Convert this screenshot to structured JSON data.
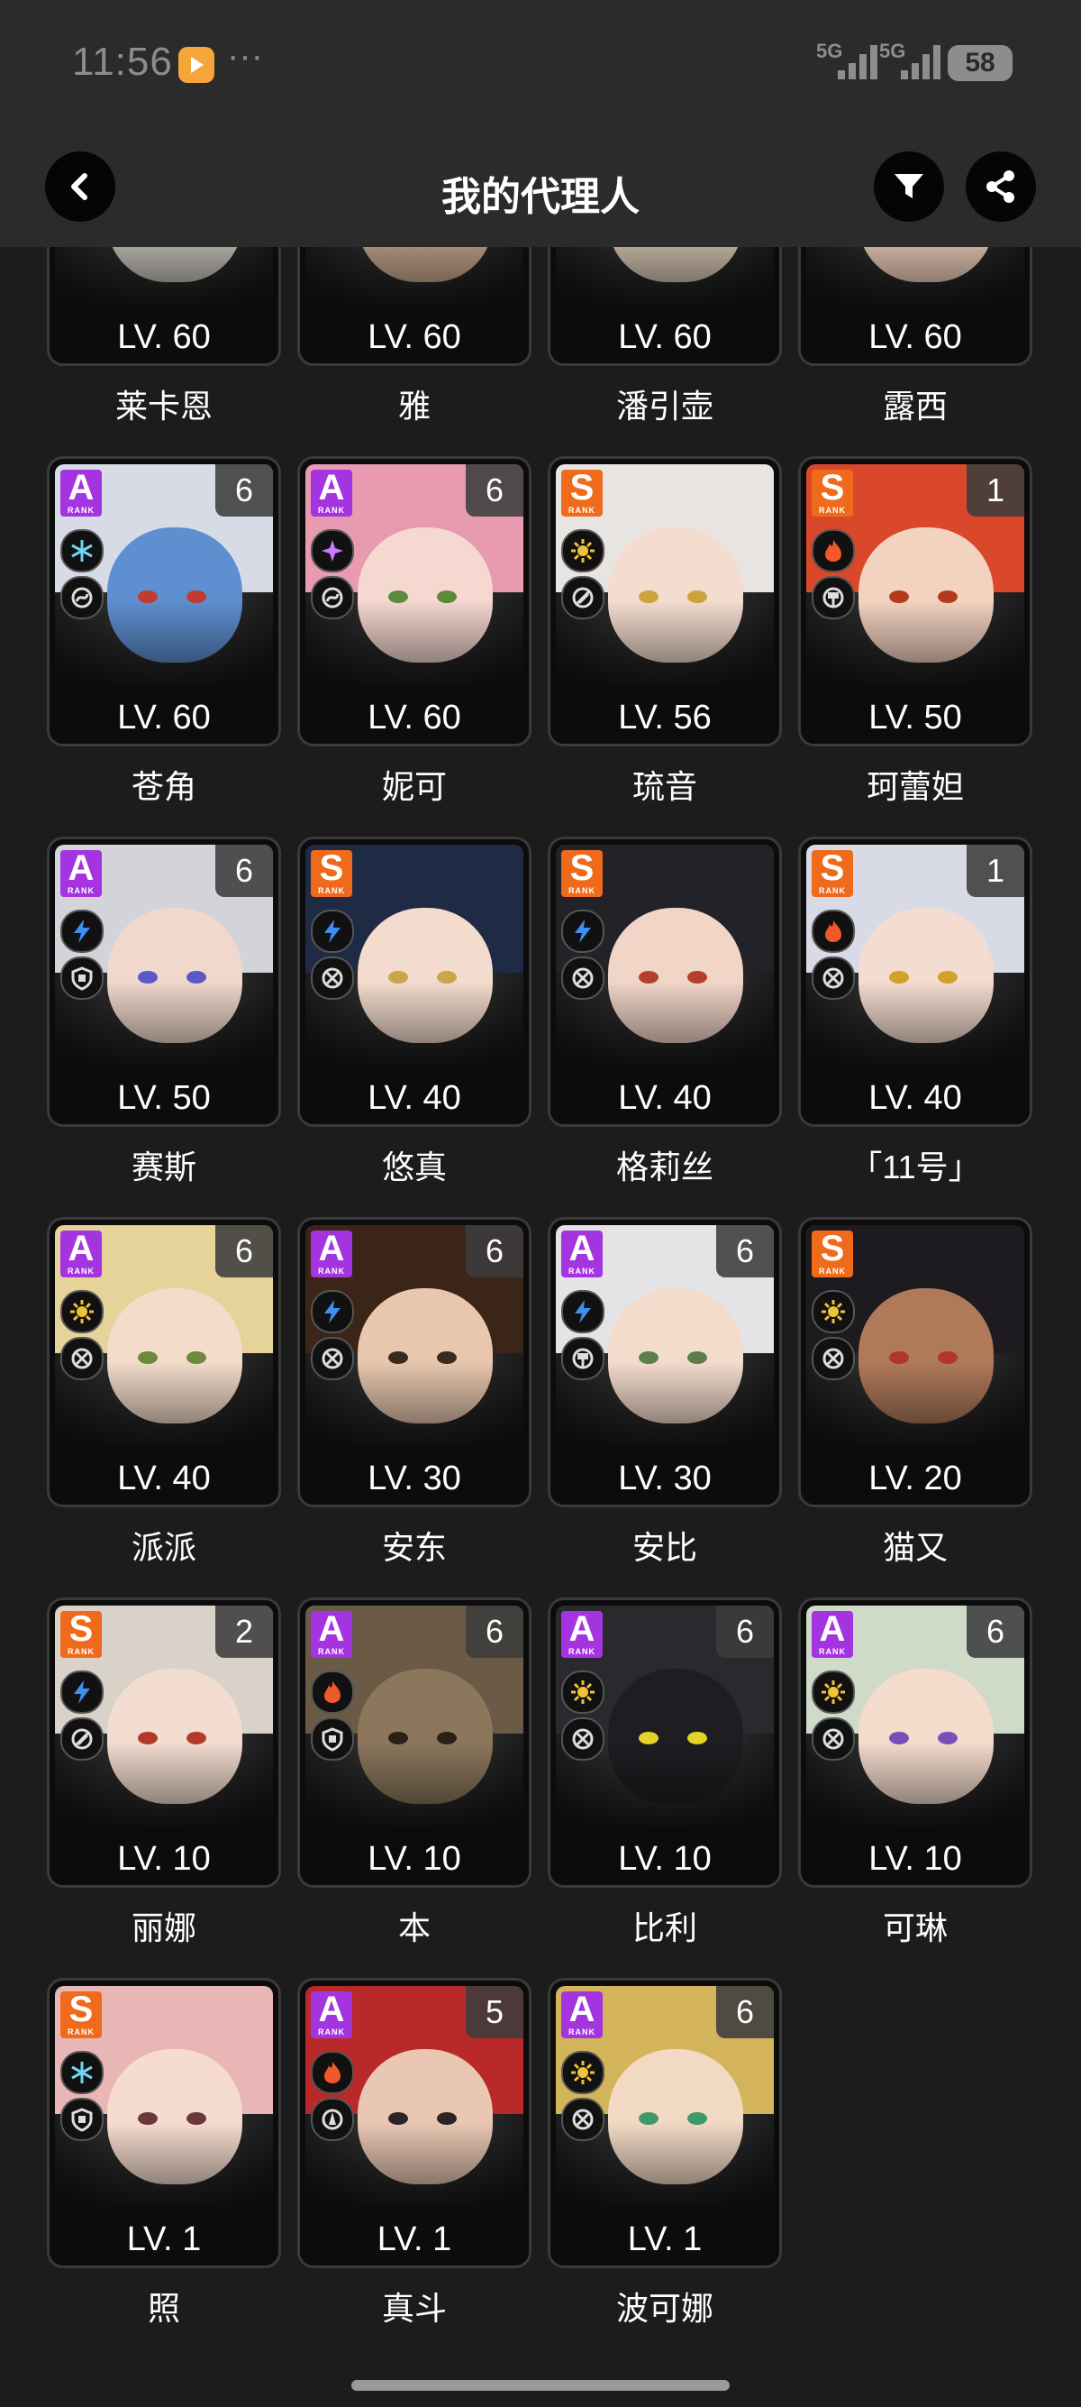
{
  "status_bar": {
    "time": "11:56",
    "more": "···",
    "signal1": "5G",
    "signal2": "5G",
    "battery": "58"
  },
  "header": {
    "title": "我的代理人"
  },
  "rank_caption": "RANK",
  "agents": [
    {
      "name": "莱卡恩",
      "level": "LV. 60",
      "rank": "",
      "mindscape": "",
      "element": "",
      "specialty": "",
      "color": "#2e2f3b",
      "skin": "#c9c4bc",
      "eye": "#9a3b3b"
    },
    {
      "name": "雅",
      "level": "LV. 60",
      "rank": "",
      "mindscape": "",
      "element": "",
      "specialty": "",
      "color": "#2f3338",
      "skin": "#c7a98f",
      "eye": "#3d3d3d"
    },
    {
      "name": "潘引壶",
      "level": "LV. 60",
      "rank": "",
      "mindscape": "",
      "element": "",
      "specialty": "",
      "color": "#bdb3a1",
      "skin": "#d7c8b4",
      "eye": "#3d3d3d"
    },
    {
      "name": "露西",
      "level": "LV. 60",
      "rank": "",
      "mindscape": "",
      "element": "",
      "specialty": "",
      "color": "#c49b6b",
      "skin": "#f0d0bc",
      "eye": "#3d3d3d"
    },
    {
      "name": "苍角",
      "level": "LV. 60",
      "rank": "A",
      "mindscape": "6",
      "element": "ice",
      "specialty": "support",
      "color": "#d6dbe6",
      "skin": "#5e8fd0",
      "eye": "#c23b2e"
    },
    {
      "name": "妮可",
      "level": "LV. 60",
      "rank": "A",
      "mindscape": "6",
      "element": "ether",
      "specialty": "support",
      "color": "#e79ab0",
      "skin": "#f5d8cf",
      "eye": "#5c8b3b"
    },
    {
      "name": "琉音",
      "level": "LV. 56",
      "rank": "S",
      "mindscape": "",
      "element": "physical",
      "specialty": "rupture",
      "color": "#e8e4e2",
      "skin": "#f4dccf",
      "eye": "#caa43a"
    },
    {
      "name": "珂蕾妲",
      "level": "LV. 50",
      "rank": "S",
      "mindscape": "1",
      "element": "fire",
      "specialty": "stun",
      "color": "#d9482a",
      "skin": "#f3d2c0",
      "eye": "#b23a1d"
    },
    {
      "name": "赛斯",
      "level": "LV. 50",
      "rank": "A",
      "mindscape": "6",
      "element": "electric",
      "specialty": "defense",
      "color": "#d2d4da",
      "skin": "#f0d8cc",
      "eye": "#5a58c8"
    },
    {
      "name": "悠真",
      "level": "LV. 40",
      "rank": "S",
      "mindscape": "",
      "element": "electric",
      "specialty": "anomaly",
      "color": "#1f2a44",
      "skin": "#f3dccd",
      "eye": "#c9a64a"
    },
    {
      "name": "格莉丝",
      "level": "LV. 40",
      "rank": "S",
      "mindscape": "",
      "element": "electric",
      "specialty": "anomaly",
      "color": "#232229",
      "skin": "#f1d6c8",
      "eye": "#b3402b"
    },
    {
      "name": "「11号」",
      "level": "LV. 40",
      "rank": "S",
      "mindscape": "1",
      "element": "fire",
      "specialty": "anomaly",
      "color": "#d8dbe6",
      "skin": "#f4dcd0",
      "eye": "#d2a12a"
    },
    {
      "name": "派派",
      "level": "LV. 40",
      "rank": "A",
      "mindscape": "6",
      "element": "physical",
      "specialty": "anomaly",
      "color": "#e6d39a",
      "skin": "#f4dccb",
      "eye": "#6b8a3b"
    },
    {
      "name": "安东",
      "level": "LV. 30",
      "rank": "A",
      "mindscape": "6",
      "element": "electric",
      "specialty": "anomaly",
      "color": "#3a2518",
      "skin": "#e8c7ae",
      "eye": "#3a2a1e"
    },
    {
      "name": "安比",
      "level": "LV. 30",
      "rank": "A",
      "mindscape": "6",
      "element": "electric",
      "specialty": "stun",
      "color": "#e4e4e6",
      "skin": "#f4dccd",
      "eye": "#5c7f4a"
    },
    {
      "name": "猫又",
      "level": "LV. 20",
      "rank": "S",
      "mindscape": "",
      "element": "physical",
      "specialty": "anomaly",
      "color": "#1e1b20",
      "skin": "#b07a5a",
      "eye": "#b1352d"
    },
    {
      "name": "丽娜",
      "level": "LV. 10",
      "rank": "S",
      "mindscape": "2",
      "element": "electric",
      "specialty": "rupture",
      "color": "#d8d2c8",
      "skin": "#f3dcd0",
      "eye": "#b13a2b"
    },
    {
      "name": "本",
      "level": "LV. 10",
      "rank": "A",
      "mindscape": "6",
      "element": "fire",
      "specialty": "defense",
      "color": "#6a5a46",
      "skin": "#8c775d",
      "eye": "#2a2018"
    },
    {
      "name": "比利",
      "level": "LV. 10",
      "rank": "A",
      "mindscape": "6",
      "element": "physical",
      "specialty": "anomaly",
      "color": "#2a2a2e",
      "skin": "#1e1e22",
      "eye": "#e4d428"
    },
    {
      "name": "可琳",
      "level": "LV. 10",
      "rank": "A",
      "mindscape": "6",
      "element": "physical",
      "specialty": "anomaly",
      "color": "#cfdac9",
      "skin": "#f4dccd",
      "eye": "#7c4db8"
    },
    {
      "name": "照",
      "level": "LV. 1",
      "rank": "S",
      "mindscape": "",
      "element": "ice",
      "specialty": "defense",
      "color": "#e9b6b6",
      "skin": "#f6dccf",
      "eye": "#6a3a3a"
    },
    {
      "name": "真斗",
      "level": "LV. 1",
      "rank": "A",
      "mindscape": "5",
      "element": "fire",
      "specialty": "attack",
      "color": "#b9292a",
      "skin": "#e9c7b3",
      "eye": "#2c2424"
    },
    {
      "name": "波可娜",
      "level": "LV. 1",
      "rank": "A",
      "mindscape": "6",
      "element": "physical",
      "specialty": "anomaly",
      "color": "#d3b45a",
      "skin": "#f2d9c4",
      "eye": "#3e9a6a"
    }
  ],
  "colors": {
    "rankS": "#f06a1b",
    "rankA": "#a434e0",
    "background": "#1c1c1c",
    "bar": "#2b2b2b"
  },
  "icons": {
    "element": {
      "ice": "snowflake-icon",
      "ether": "ether-star-icon",
      "physical": "physical-burst-icon",
      "fire": "flame-icon",
      "electric": "lightning-icon"
    },
    "specialty": {
      "support": "support-swirl-icon",
      "rupture": "rupture-icon",
      "stun": "stun-hammer-icon",
      "defense": "shield-icon",
      "anomaly": "anomaly-cross-icon",
      "attack": "attack-blade-icon"
    }
  }
}
